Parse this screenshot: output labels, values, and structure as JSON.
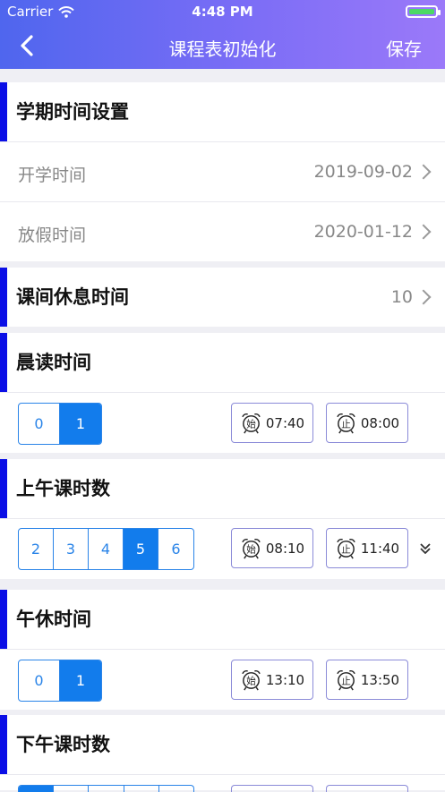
{
  "status": {
    "carrier": "Carrier",
    "time": "4:48 PM"
  },
  "nav": {
    "title": "课程表初始化",
    "save": "保存"
  },
  "term": {
    "title": "学期时间设置",
    "start_label": "开学时间",
    "start_value": "2019-09-02",
    "end_label": "放假时间",
    "end_value": "2020-01-12"
  },
  "break": {
    "title": "课间休息时间",
    "value": "10"
  },
  "morning_read": {
    "title": "晨读时间",
    "options": [
      "0",
      "1"
    ],
    "selected": "1",
    "start_glyph": "始",
    "start_time": "07:40",
    "end_glyph": "止",
    "end_time": "08:00"
  },
  "am": {
    "title": "上午课时数",
    "options": [
      "2",
      "3",
      "4",
      "5",
      "6"
    ],
    "selected": "5",
    "start_glyph": "始",
    "start_time": "08:10",
    "end_glyph": "止",
    "end_time": "11:40"
  },
  "nap": {
    "title": "午休时间",
    "options": [
      "0",
      "1"
    ],
    "selected": "1",
    "start_glyph": "始",
    "start_time": "13:10",
    "end_glyph": "止",
    "end_time": "13:50"
  },
  "pm": {
    "title": "下午课时数"
  },
  "colors": {
    "accent_bar": "#0b0fe6",
    "segment_blue": "#127cec",
    "header_start": "#4f66ee",
    "header_end": "#9b79f9"
  },
  "icons": [
    "wifi-icon",
    "battery-icon",
    "back-arrow-icon",
    "chevron-right-icon",
    "alarm-clock-icon",
    "expand-down-icon"
  ]
}
